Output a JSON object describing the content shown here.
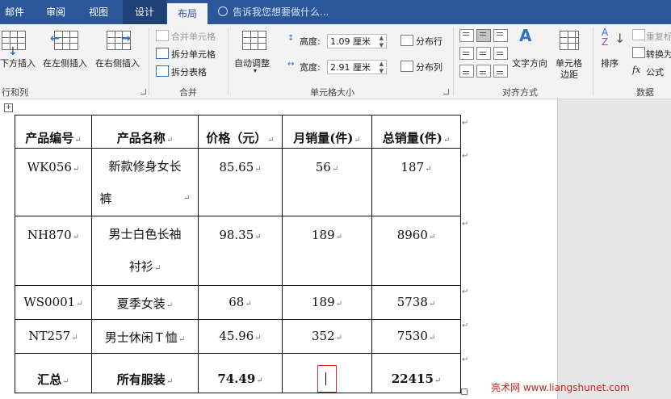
{
  "tabs": [
    {
      "label": "邮件"
    },
    {
      "label": "审阅"
    },
    {
      "label": "视图"
    },
    {
      "label": "设计"
    },
    {
      "label": "布局"
    }
  ],
  "tell_me": "告诉我您想要做什么...",
  "ribbon": {
    "rows_cols": {
      "insert_below": "下方插入",
      "insert_left": "在左侧插入",
      "insert_right": "在右侧插入",
      "group_label": "行和列"
    },
    "merge": {
      "merge_cells": "合并单元格",
      "split_cells": "拆分单元格",
      "split_table": "拆分表格",
      "group_label": "合并"
    },
    "cell_size": {
      "autofit": "自动调整",
      "height_label": "高度:",
      "height_value": "1.09 厘米",
      "width_label": "宽度:",
      "width_value": "2.91 厘米",
      "distribute_rows": "分布行",
      "distribute_cols": "分布列",
      "group_label": "单元格大小"
    },
    "alignment": {
      "text_direction": "文字方向",
      "cell_margins_1": "单元格",
      "cell_margins_2": "边距",
      "group_label": "对齐方式"
    },
    "data": {
      "sort": "排序",
      "repeat_header": "重复标",
      "convert": "转换为",
      "formula": "公式",
      "group_label": "数据"
    }
  },
  "table": {
    "headers": [
      "产品编号",
      "产品名称",
      "价格（元）",
      "月销量(件)",
      "总销量(件)"
    ],
    "rows": [
      {
        "id": "WK056",
        "name_1": "新款修身女长",
        "name_2": "裤",
        "price": "85.65",
        "monthly": "56",
        "total": "187"
      },
      {
        "id": "NH870",
        "name_1": "男士白色长袖",
        "name_2": "衬衫",
        "price": "98.35",
        "monthly": "189",
        "total": "8960"
      },
      {
        "id": "WS0001",
        "name": "夏季女装",
        "price": "68",
        "monthly": "189",
        "total": "5738"
      },
      {
        "id": "NT257",
        "name": "男士休闲Ｔ恤",
        "price": "45.96",
        "monthly": "352",
        "total": "7530"
      }
    ],
    "summary": {
      "label": "汇总",
      "name": "所有服装",
      "price": "74.49",
      "monthly": "",
      "total": "22415"
    }
  },
  "paragraph_mark": "↵",
  "watermark": "亮术网 www.liangshunet.com"
}
